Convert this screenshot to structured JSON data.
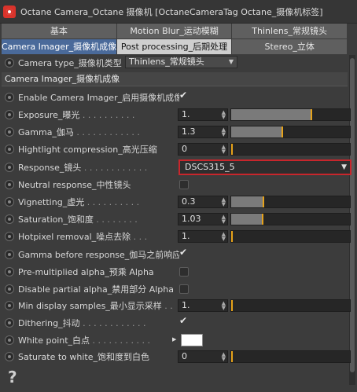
{
  "window": {
    "title": "Octane Camera_Octane 摄像机 [OctaneCameraTag Octane_摄像机标签]"
  },
  "tabs": {
    "row1": [
      "基本",
      "Motion Blur_运动模糊",
      "Thinlens_常规镜头"
    ],
    "row2": [
      "Camera Imager_摄像机成像",
      "Post processing_后期处理",
      "Stereo_立体"
    ]
  },
  "camera_type": {
    "label": "Camera type_摄像机类型",
    "value": "Thinlens_常规镜头"
  },
  "section": {
    "title": "Camera Imager_摄像机成像"
  },
  "params": {
    "enable": {
      "label": "Enable Camera Imager_启用摄像机成像",
      "checked": true
    },
    "exposure": {
      "label": "Exposure_曝光",
      "value": "1.",
      "level": 0.68
    },
    "gamma": {
      "label": "Gamma_伽马",
      "value": "1.3",
      "level": 0.43
    },
    "highlight": {
      "label": "Hightlight compression_高光压缩",
      "value": "0",
      "level": 0.0
    },
    "response": {
      "label": "Response_镜头",
      "value": "DSCS315_5"
    },
    "neutral": {
      "label": "Neutral response_中性镜头",
      "checked": false
    },
    "vignetting": {
      "label": "Vignetting_虚光",
      "value": "0.3",
      "level": 0.27
    },
    "saturation": {
      "label": "Saturation_饱和度",
      "value": "1.03",
      "level": 0.26
    },
    "hotpixel": {
      "label": "Hotpixel removal_噪点去除",
      "value": "1.",
      "level": 0.0
    },
    "gamma_before": {
      "label": "Gamma before response_伽马之前响应",
      "checked": true
    },
    "premultiplied": {
      "label": "Pre-multiplied alpha_预乘 Alpha",
      "checked": false
    },
    "disable_partial": {
      "label": "Disable partial alpha_禁用部分 Alpha",
      "checked": false
    },
    "min_display": {
      "label": "Min display samples_最小显示采样",
      "value": "1.",
      "level": 0.0
    },
    "dithering": {
      "label": "Dithering_抖动",
      "checked": true
    },
    "white_point": {
      "label": "White point_白点",
      "color": "#ffffff"
    },
    "saturate_white": {
      "label": "Saturate to white_饱和度到白色",
      "value": "0",
      "level": 0.0
    }
  },
  "colors": {
    "accent": "#e6a21a",
    "highlight_border": "#c8262c"
  },
  "help": {
    "glyph": "?"
  }
}
